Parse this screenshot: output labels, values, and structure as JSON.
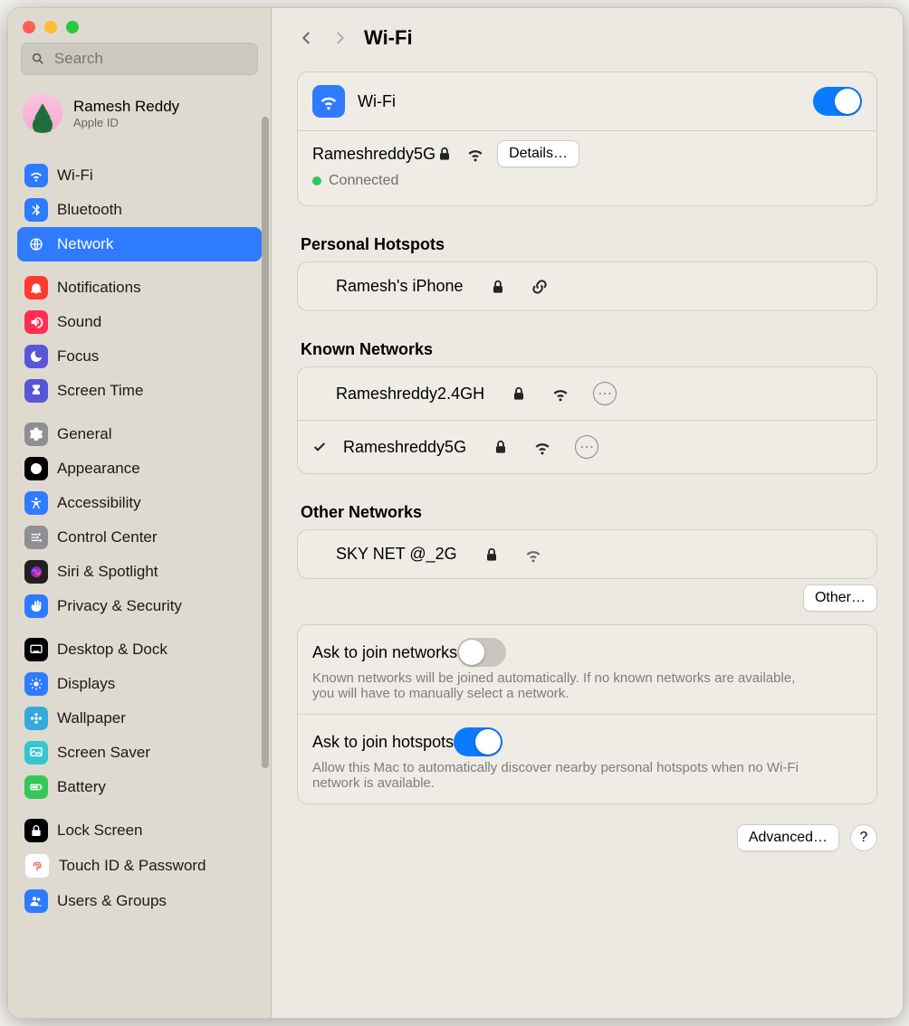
{
  "window": {
    "title": "Wi-Fi"
  },
  "search": {
    "placeholder": "Search"
  },
  "profile": {
    "name": "Ramesh Reddy",
    "sub": "Apple ID"
  },
  "sidebar_groups": [
    [
      {
        "icon": "wifi",
        "color": "#2f7bff",
        "label": "Wi-Fi",
        "selected": false
      },
      {
        "icon": "bluetooth",
        "color": "#2f7bff",
        "label": "Bluetooth",
        "selected": false
      },
      {
        "icon": "globe",
        "color": "#2f7bff",
        "label": "Network",
        "selected": true
      }
    ],
    [
      {
        "icon": "bell",
        "color": "#ff3b30",
        "label": "Notifications"
      },
      {
        "icon": "speaker",
        "color": "#ff2d55",
        "label": "Sound"
      },
      {
        "icon": "moon",
        "color": "#5856d6",
        "label": "Focus"
      },
      {
        "icon": "hourglass",
        "color": "#5856d6",
        "label": "Screen Time"
      }
    ],
    [
      {
        "icon": "gear",
        "color": "#8e8e93",
        "label": "General"
      },
      {
        "icon": "appearance",
        "color": "#000000",
        "label": "Appearance"
      },
      {
        "icon": "accessibility",
        "color": "#2f7bff",
        "label": "Accessibility"
      },
      {
        "icon": "sliders",
        "color": "#8e8e93",
        "label": "Control Center"
      },
      {
        "icon": "siri",
        "color": "#202020",
        "label": "Siri & Spotlight"
      },
      {
        "icon": "hand",
        "color": "#2f7bff",
        "label": "Privacy & Security"
      }
    ],
    [
      {
        "icon": "dock",
        "color": "#000000",
        "label": "Desktop & Dock"
      },
      {
        "icon": "displays",
        "color": "#2f7bff",
        "label": "Displays"
      },
      {
        "icon": "flower",
        "color": "#34aadc",
        "label": "Wallpaper"
      },
      {
        "icon": "screensaver",
        "color": "#34c7d1",
        "label": "Screen Saver"
      },
      {
        "icon": "battery",
        "color": "#34c759",
        "label": "Battery"
      }
    ],
    [
      {
        "icon": "lock",
        "color": "#000000",
        "label": "Lock Screen"
      },
      {
        "icon": "fingerprint",
        "color": "#ffffff",
        "label": "Touch ID & Password",
        "fg": "#ff3b30"
      },
      {
        "icon": "users",
        "color": "#2f7bff",
        "label": "Users & Groups"
      }
    ]
  ],
  "wifi_card": {
    "title": "Wi-Fi",
    "enabled": true,
    "network": "Rameshreddy5G",
    "status": "Connected",
    "details_btn": "Details…"
  },
  "hotspots": {
    "title": "Personal Hotspots",
    "items": [
      {
        "name": "Ramesh's iPhone"
      }
    ]
  },
  "known": {
    "title": "Known Networks",
    "items": [
      {
        "name": "Rameshreddy2.4GH",
        "checked": false
      },
      {
        "name": "Rameshreddy5G",
        "checked": true
      }
    ]
  },
  "other_networks": {
    "title": "Other Networks",
    "items": [
      {
        "name": "SKY NET @_2G"
      }
    ],
    "other_btn": "Other…"
  },
  "options": {
    "ask_networks": {
      "title": "Ask to join networks",
      "desc": "Known networks will be joined automatically. If no known networks are available, you will have to manually select a network.",
      "on": false
    },
    "ask_hotspots": {
      "title": "Ask to join hotspots",
      "desc": "Allow this Mac to automatically discover nearby personal hotspots when no Wi-Fi network is available.",
      "on": true
    }
  },
  "footer": {
    "advanced": "Advanced…",
    "help": "?"
  }
}
